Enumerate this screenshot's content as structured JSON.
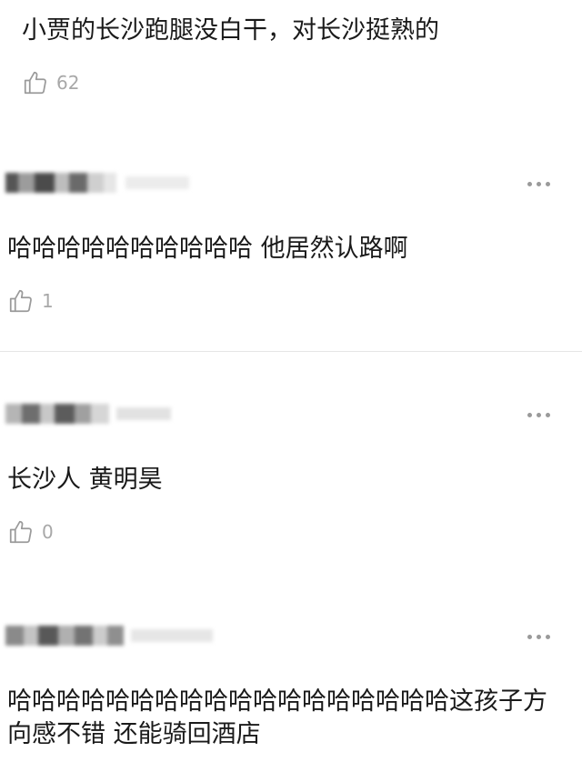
{
  "comments": [
    {
      "text": "小贾的长沙跑腿没白干，对长沙挺熟的",
      "likes": "62"
    },
    {
      "text": "哈哈哈哈哈哈哈哈哈哈 他居然认路啊",
      "likes": "1"
    },
    {
      "text": "长沙人 黄明昊",
      "likes": "0"
    },
    {
      "text": "哈哈哈哈哈哈哈哈哈哈哈哈哈哈哈哈哈哈这孩子方向感不错 还能骑回酒店"
    }
  ],
  "icons": {
    "like": "thumbs-up-icon",
    "more": "more-dots-icon"
  }
}
